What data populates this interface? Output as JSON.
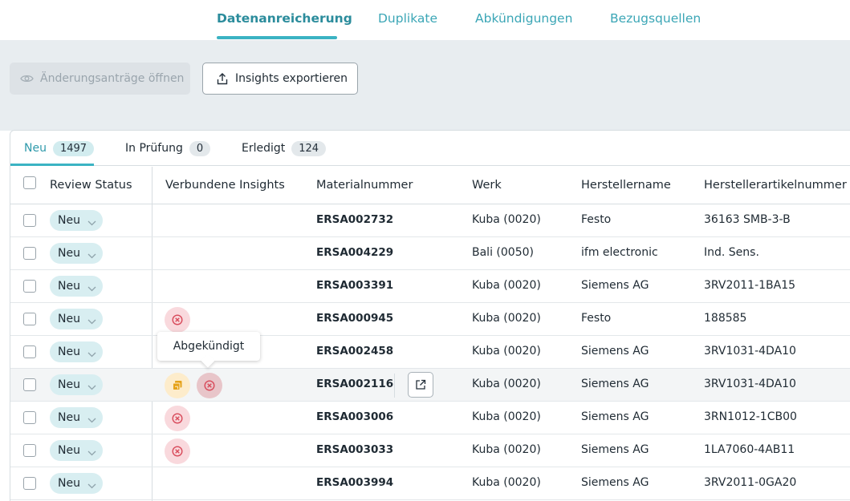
{
  "nav": {
    "tabs": [
      {
        "label": "Datenanreicherung",
        "active": true
      },
      {
        "label": "Duplikate"
      },
      {
        "label": "Abkündigungen"
      },
      {
        "label": "Bezugsquellen"
      }
    ]
  },
  "toolbar": {
    "open_requests_label": "Änderungsanträge öffnen",
    "export_label": "Insights exportieren"
  },
  "subtabs": [
    {
      "label": "Neu",
      "count": "1497",
      "active": true
    },
    {
      "label": "In Prüfung",
      "count": "0"
    },
    {
      "label": "Erledigt",
      "count": "124"
    }
  ],
  "table": {
    "headers": {
      "review_status": "Review Status",
      "insights": "Verbundene Insights",
      "material": "Materialnummer",
      "werk": "Werk",
      "hersteller": "Herstellername",
      "artikel": "Herstellerartikelnummer"
    },
    "rows": [
      {
        "status": "Neu",
        "insights": [],
        "material": "ERSA002732",
        "werk": "Kuba (0020)",
        "hersteller": "Festo",
        "artikel": "36163 SMB-3-B"
      },
      {
        "status": "Neu",
        "insights": [],
        "material": "ERSA004229",
        "werk": "Bali (0050)",
        "hersteller": "ifm electronic",
        "artikel": "Ind. Sens."
      },
      {
        "status": "Neu",
        "insights": [],
        "material": "ERSA003391",
        "werk": "Kuba (0020)",
        "hersteller": "Siemens AG",
        "artikel": "3RV2011-1BA15"
      },
      {
        "status": "Neu",
        "insights": [
          "discontinued"
        ],
        "material": "ERSA000945",
        "werk": "Kuba (0020)",
        "hersteller": "Festo",
        "artikel": "188585"
      },
      {
        "status": "Neu",
        "insights": [],
        "material": "ERSA002458",
        "werk": "Kuba (0020)",
        "hersteller": "Siemens AG",
        "artikel": "3RV1031-4DA10"
      },
      {
        "status": "Neu",
        "insights": [
          "duplicate",
          "discontinued"
        ],
        "material": "ERSA002116",
        "werk": "Kuba (0020)",
        "hersteller": "Siemens AG",
        "artikel": "3RV1031-4DA10"
      },
      {
        "status": "Neu",
        "insights": [
          "discontinued"
        ],
        "material": "ERSA003006",
        "werk": "Kuba (0020)",
        "hersteller": "Siemens AG",
        "artikel": "3RN1012-1CB00"
      },
      {
        "status": "Neu",
        "insights": [
          "discontinued"
        ],
        "material": "ERSA003033",
        "werk": "Kuba (0020)",
        "hersteller": "Siemens AG",
        "artikel": "1LA7060-4AB11"
      },
      {
        "status": "Neu",
        "insights": [],
        "material": "ERSA003994",
        "werk": "Kuba (0020)",
        "hersteller": "Siemens AG",
        "artikel": "3RV2011-0GA20"
      }
    ]
  },
  "tooltip": {
    "text": "Abgekündigt"
  },
  "colors": {
    "accent": "#3bb3c3",
    "status_bg": "#d8eef1",
    "insight_red": "#d84a5a",
    "insight_yellow": "#e5a21a"
  },
  "icons": {
    "eye": "eye-icon",
    "export": "export-icon",
    "chevron": "chevron-down-icon",
    "discontinued": "x-circle-icon",
    "duplicate": "copy-icon",
    "open": "external-link-icon"
  }
}
